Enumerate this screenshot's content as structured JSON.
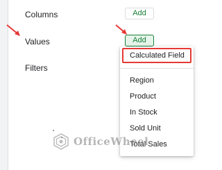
{
  "sections": {
    "columns": "Columns",
    "values": "Values",
    "filters": "Filters"
  },
  "buttons": {
    "columns_add": "Add",
    "values_add": "Add"
  },
  "menu": {
    "highlighted": "Calculated Field",
    "items": [
      "Region",
      "Product",
      "In Stock",
      "Sold Unit",
      "Total Sales"
    ]
  },
  "watermark": {
    "text": "OfficeWheel"
  },
  "colors": {
    "accent_green": "#188038",
    "highlight_red": "#e53935",
    "arrow_red": "#e53935"
  }
}
